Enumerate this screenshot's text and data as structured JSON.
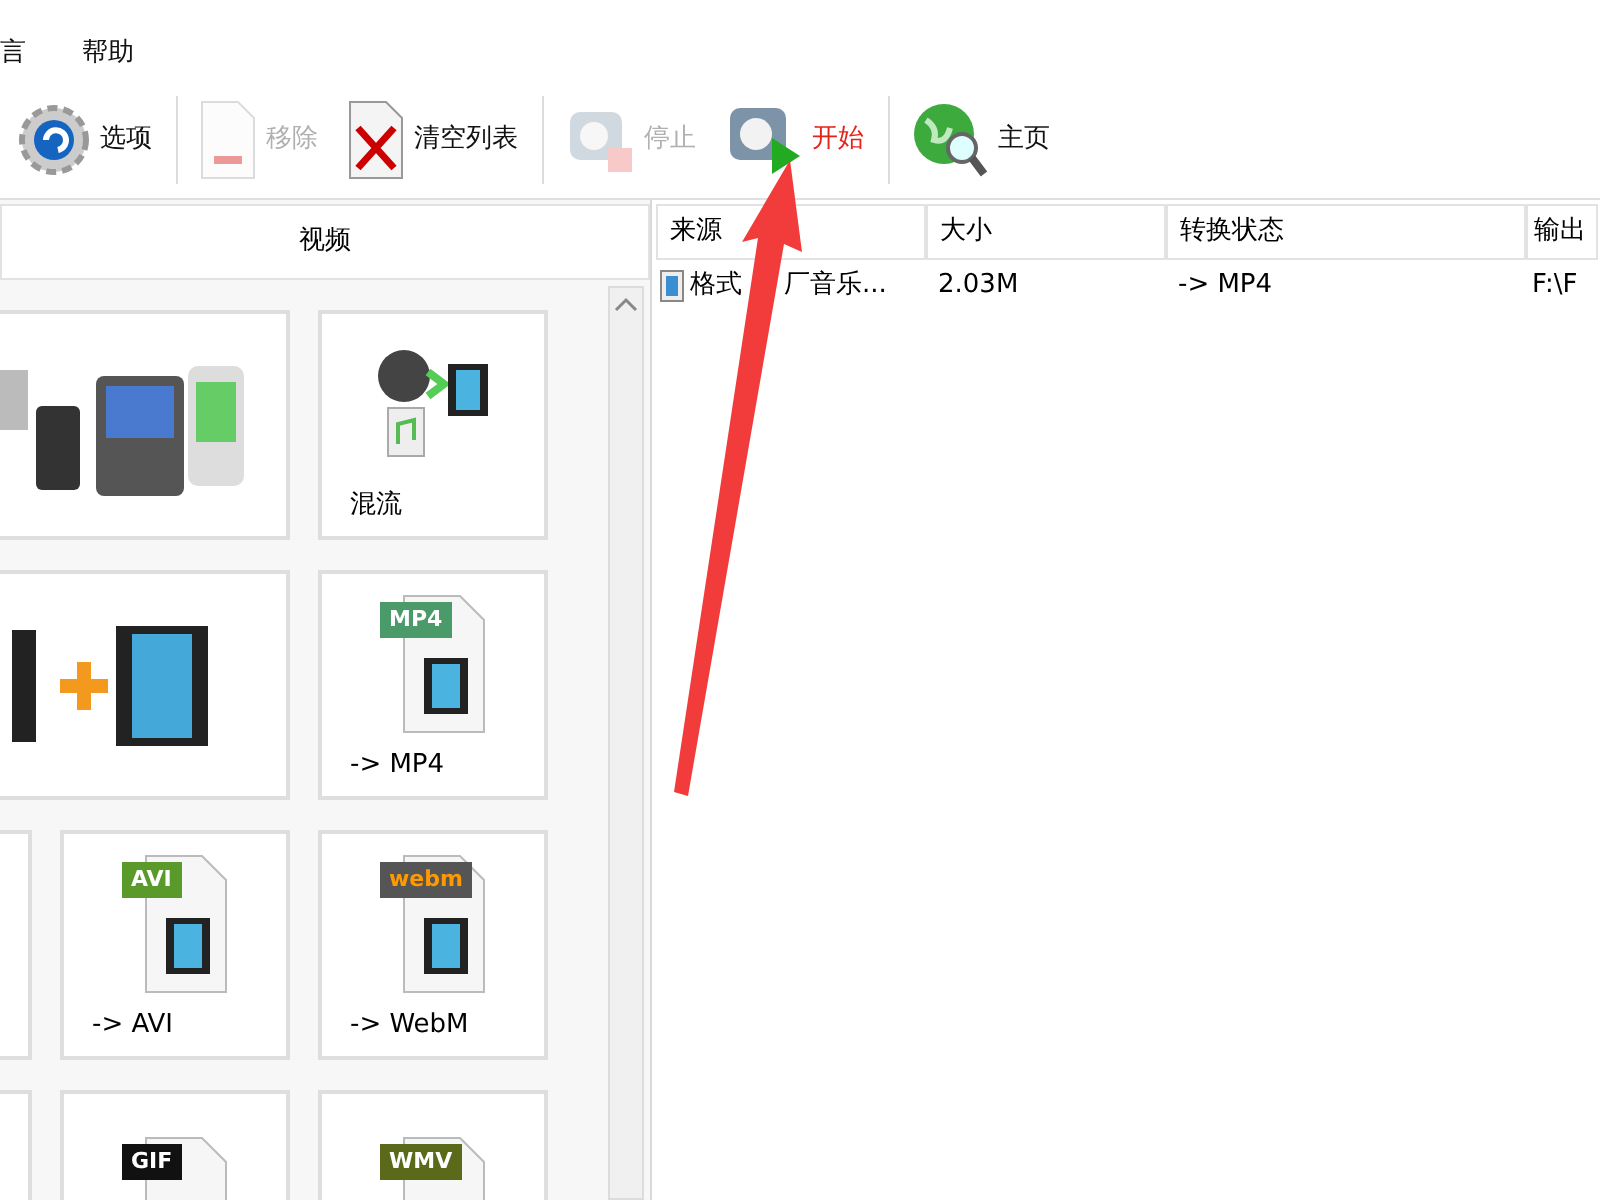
{
  "menu": [
    {
      "label": "言"
    },
    {
      "label": "帮助"
    }
  ],
  "toolbar": [
    {
      "kind": "options",
      "label": "选项",
      "disabled": false,
      "highlighted": false
    },
    {
      "kind": "remove",
      "label": "移除",
      "disabled": true,
      "highlighted": false
    },
    {
      "kind": "clear",
      "label": "清空列表",
      "disabled": false,
      "highlighted": false
    },
    {
      "kind": "stop",
      "label": "停止",
      "disabled": true,
      "highlighted": false
    },
    {
      "kind": "start",
      "label": "开始",
      "disabled": false,
      "highlighted": true
    },
    {
      "kind": "home",
      "label": "主页",
      "disabled": false,
      "highlighted": false
    }
  ],
  "panel": {
    "title": "视频",
    "tiles": [
      {
        "kind": "devices",
        "wide": true
      },
      {
        "kind": "mux",
        "label": "混流"
      },
      {
        "kind": "join",
        "wide": true
      },
      {
        "kind": "file",
        "badge": "MP4",
        "label": "-> MP4"
      },
      {
        "kind": "cut"
      },
      {
        "kind": "file",
        "badge": "AVI",
        "label": "-> AVI"
      },
      {
        "kind": "file",
        "badge": "webm",
        "label": "-> WebM"
      },
      {
        "kind": "cut"
      },
      {
        "kind": "file",
        "badge": "GIF"
      },
      {
        "kind": "file",
        "badge": "WMV"
      }
    ]
  },
  "table": {
    "columns": [
      "来源",
      "大小",
      "转换状态",
      "输出"
    ],
    "rows": [
      [
        [
          "格式",
          "厂音乐..."
        ],
        "2.03M",
        "-> MP4",
        "F:\\F"
      ]
    ]
  }
}
